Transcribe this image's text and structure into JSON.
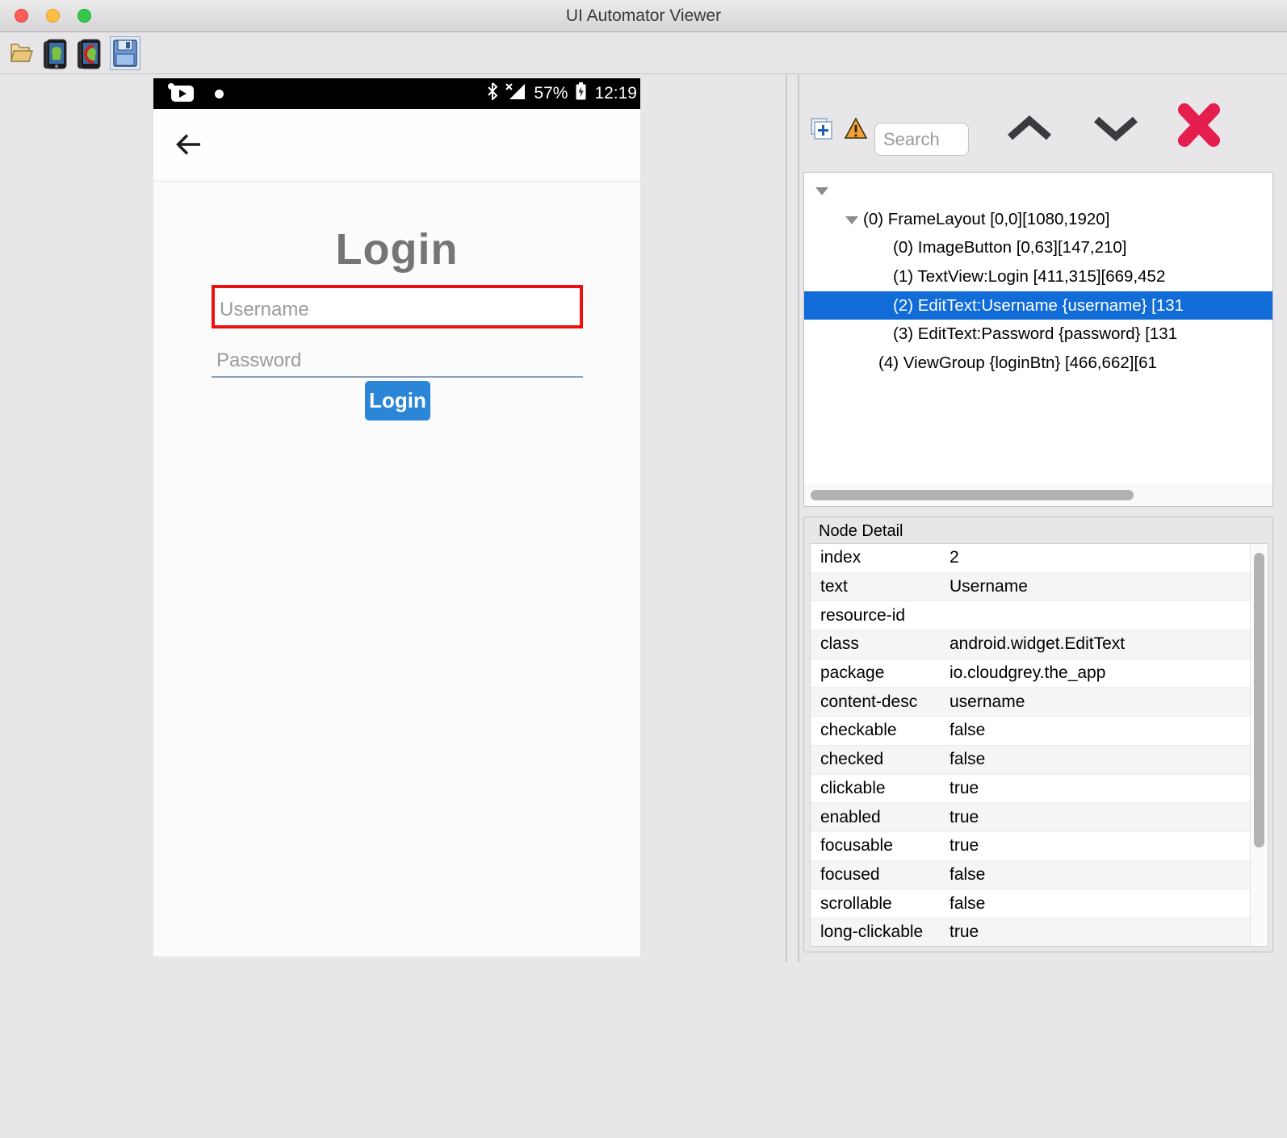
{
  "window": {
    "title": "UI Automator Viewer"
  },
  "toolbar": {
    "icons": [
      {
        "name": "open-file"
      },
      {
        "name": "device-screenshot"
      },
      {
        "name": "device-screenshot-compressed"
      },
      {
        "name": "save-screenshot"
      }
    ]
  },
  "phone": {
    "status_bar": {
      "battery_pct": "57%",
      "time": "12:19"
    },
    "app": {
      "title": "Login",
      "username_placeholder": "Username",
      "password_placeholder": "Password",
      "login_button": "Login"
    }
  },
  "tree_panel": {
    "search_placeholder": "Search",
    "nodes": [
      {
        "depth": 0,
        "expander": "down",
        "label": "",
        "selected": false
      },
      {
        "depth": 1,
        "expander": "down",
        "label": "(0) FrameLayout [0,0][1080,1920]",
        "selected": false
      },
      {
        "depth": 2,
        "expander": "none",
        "label": "(0) ImageButton [0,63][147,210]",
        "selected": false
      },
      {
        "depth": 2,
        "expander": "none",
        "label": "(1) TextView:Login [411,315][669,452",
        "selected": false
      },
      {
        "depth": 2,
        "expander": "none",
        "label": "(2) EditText:Username {username} [131",
        "selected": true
      },
      {
        "depth": 2,
        "expander": "none",
        "label": "(3) EditText:Password {password} [131",
        "selected": false
      },
      {
        "depth": 2,
        "expander": "right",
        "label": "(4) ViewGroup {loginBtn} [466,662][61",
        "selected": false
      }
    ]
  },
  "node_detail": {
    "title": "Node Detail",
    "rows": [
      {
        "key": "index",
        "value": "2"
      },
      {
        "key": "text",
        "value": "Username"
      },
      {
        "key": "resource-id",
        "value": ""
      },
      {
        "key": "class",
        "value": "android.widget.EditText"
      },
      {
        "key": "package",
        "value": "io.cloudgrey.the_app"
      },
      {
        "key": "content-desc",
        "value": "username"
      },
      {
        "key": "checkable",
        "value": "false"
      },
      {
        "key": "checked",
        "value": "false"
      },
      {
        "key": "clickable",
        "value": "true"
      },
      {
        "key": "enabled",
        "value": "true"
      },
      {
        "key": "focusable",
        "value": "true"
      },
      {
        "key": "focused",
        "value": "false"
      },
      {
        "key": "scrollable",
        "value": "false"
      },
      {
        "key": "long-clickable",
        "value": "true"
      }
    ]
  },
  "colors": {
    "selection_blue": "#116cd8",
    "highlight_red": "#ee1111",
    "login_button_blue": "#2b86d8",
    "close_x_red": "#e61e50",
    "warning_orange": "#f2a33c"
  }
}
